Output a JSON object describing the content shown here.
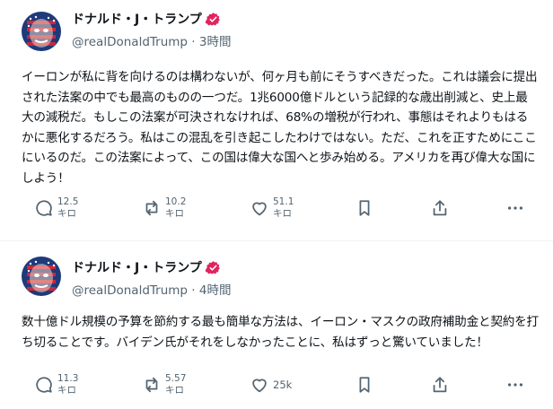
{
  "posts": [
    {
      "author": {
        "name": "ドナルド・J・トランプ",
        "verified_icon": "verified-badge-icon"
      },
      "handle": "@realDonaldTrump",
      "separator": "·",
      "time": "3時間",
      "body": "イーロンが私に背を向けるのは構わないが、何ヶ月も前にそうすべきだった。これは議会に提出された法案の中でも最高のものの一つだ。1兆6000億ドルという記録的な歳出削減と、史上最大の減税だ。もしこの法案が可決されなければ、68%の増税が行われ、事態はそれよりもはるかに悪化するだろう。私はこの混乱を引き起こしたわけではない。ただ、これを正すためにここにいるのだ。この法案によって、この国は偉大な国へと歩み始める。アメリカを再び偉大な国にしよう！",
      "actions": {
        "reply": {
          "value": "12.5",
          "unit": "キロ"
        },
        "repost": {
          "value": "10.2",
          "unit": "キロ"
        },
        "like": {
          "value": "51.1",
          "unit": "キロ"
        }
      }
    },
    {
      "author": {
        "name": "ドナルド・J・トランプ",
        "verified_icon": "verified-badge-icon"
      },
      "handle": "@realDonaldTrump",
      "separator": "·",
      "time": "4時間",
      "body": "数十億ドル規模の予算を節約する最も簡単な方法は、イーロン・マスクの政府補助金と契約を打ち切ることです。バイデン氏がそれをしなかったことに、私はずっと驚いていました！",
      "actions": {
        "reply": {
          "value": "11.3",
          "unit": "キロ"
        },
        "repost": {
          "value": "5.57",
          "unit": "キロ"
        },
        "like": {
          "value": "25k"
        }
      }
    }
  ],
  "colors": {
    "text": "#0f1419",
    "secondary": "#536471",
    "badge": "#e0245e",
    "divider": "#eff3f4"
  },
  "icons": [
    "avatar-flag-face",
    "verified-badge-icon",
    "reply-icon",
    "repost-icon",
    "like-icon",
    "bookmark-icon",
    "share-icon",
    "more-icon"
  ]
}
